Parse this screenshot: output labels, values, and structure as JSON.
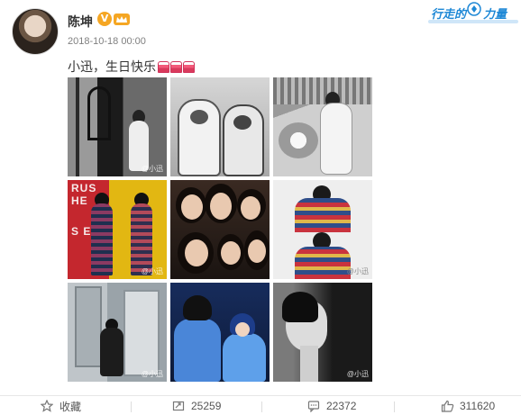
{
  "post": {
    "author": "陈坤",
    "verified_badge": "V",
    "timestamp": "2018-10-18 00:00",
    "text": "小迅，生日快乐",
    "emoji_count": 3
  },
  "topic_badge": {
    "label_part1": "行走的",
    "label_part2": "力量"
  },
  "photos": [
    {
      "watermark": "@小迅"
    },
    {
      "watermark": ""
    },
    {
      "watermark": ""
    },
    {
      "watermark": "@小迅"
    },
    {
      "watermark": ""
    },
    {
      "watermark": "@小迅"
    },
    {
      "watermark": "@小迅"
    },
    {
      "watermark": ""
    },
    {
      "watermark": "@小迅"
    }
  ],
  "actions": {
    "favorite_label": "收藏",
    "repost_count": "25259",
    "comment_count": "22372",
    "like_count": "311620"
  },
  "colors": {
    "accent_blue": "#1e88d6",
    "verified_orange": "#f5a623",
    "cake_pink": "#f25a7a"
  }
}
